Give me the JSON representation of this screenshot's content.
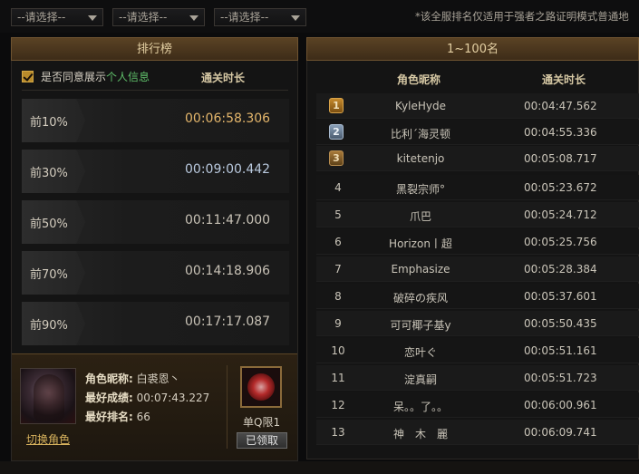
{
  "filters": [
    {
      "label": "--请选择--"
    },
    {
      "label": "--请选择--"
    },
    {
      "label": "--请选择--"
    }
  ],
  "note": "*该全服排名仅适用于强者之路证明模式普通地",
  "left": {
    "title": "排行榜",
    "optin_label": "是否同意展示",
    "optin_link": "个人信息",
    "optin_checked": true,
    "time_header": "通关时长",
    "tiers": [
      {
        "pct": "前10%",
        "time": "00:06:58.306"
      },
      {
        "pct": "前30%",
        "time": "00:09:00.442"
      },
      {
        "pct": "前50%",
        "time": "00:11:47.000"
      },
      {
        "pct": "前70%",
        "time": "00:14:18.906"
      },
      {
        "pct": "前90%",
        "time": "00:17:17.087"
      }
    ],
    "profile": {
      "name_key": "角色昵称:",
      "name_val": "白裘恩丶",
      "best_key": "最好成绩:",
      "best_val": "00:07:43.227",
      "rank_key": "最好排名:",
      "rank_val": "66",
      "switch_label": "切换角色",
      "reward_label": "单Q限1",
      "claimed_label": "已领取"
    }
  },
  "right": {
    "title": "1~100名",
    "col_name": "角色昵称",
    "col_time": "通关时长",
    "rows": [
      {
        "rank": "1",
        "name": "KyleHyde",
        "time": "00:04:47.562"
      },
      {
        "rank": "2",
        "name": "比利΄海灵顿",
        "time": "00:04:55.336"
      },
      {
        "rank": "3",
        "name": "kitetenjo",
        "time": "00:05:08.717"
      },
      {
        "rank": "4",
        "name": "黑裂宗师°",
        "time": "00:05:23.672"
      },
      {
        "rank": "5",
        "name": "爪巴",
        "time": "00:05:24.712"
      },
      {
        "rank": "6",
        "name": "Horizon丨超",
        "time": "00:05:25.756"
      },
      {
        "rank": "7",
        "name": "Emphasize",
        "time": "00:05:28.384"
      },
      {
        "rank": "8",
        "name": "破碎の疾风",
        "time": "00:05:37.601"
      },
      {
        "rank": "9",
        "name": "可可椰子基y",
        "time": "00:05:50.435"
      },
      {
        "rank": "10",
        "name": "恋叶ぐ",
        "time": "00:05:51.161"
      },
      {
        "rank": "11",
        "name": "淀真嗣",
        "time": "00:05:51.723"
      },
      {
        "rank": "12",
        "name": "呆。。了。。",
        "time": "00:06:00.961"
      },
      {
        "rank": "13",
        "name": "神　木　麗",
        "time": "00:06:09.741"
      }
    ]
  }
}
